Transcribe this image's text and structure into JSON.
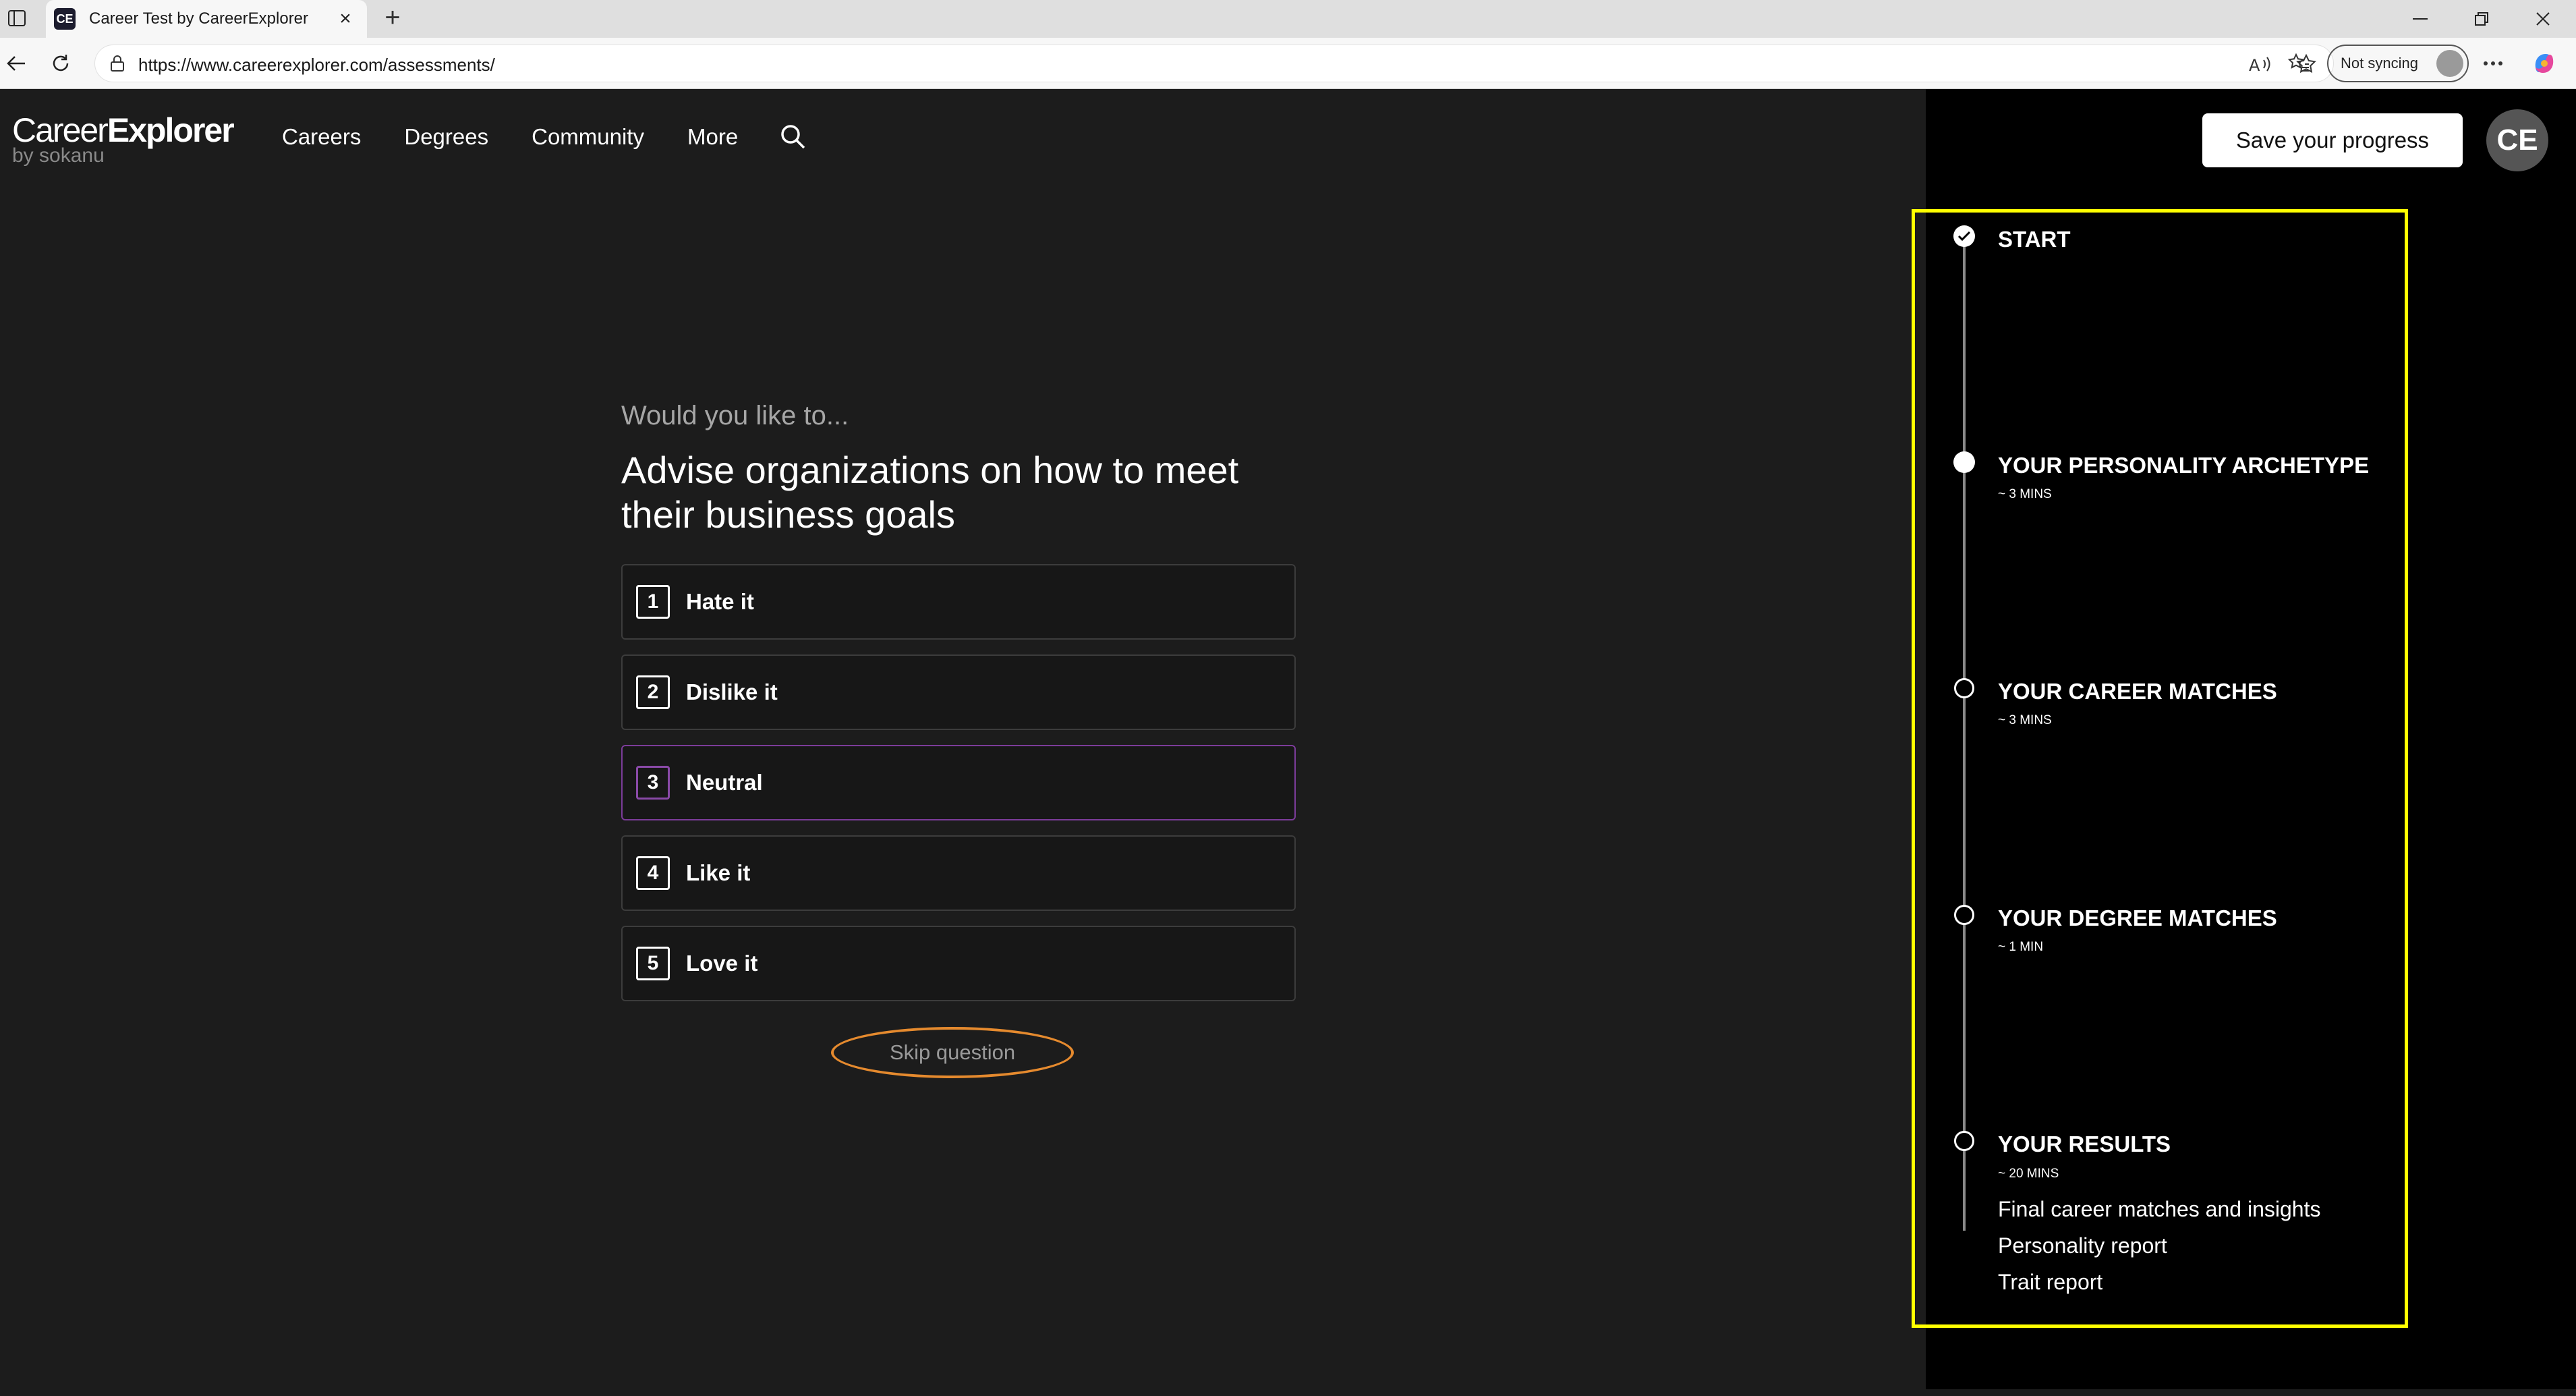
{
  "browser": {
    "tab_title": "Career Test by CareerExplorer",
    "tab_favicon": "CE",
    "new_tab_symbol": "+",
    "url": "https://www.careerexplorer.com/assessments/",
    "sync_label": "Not syncing"
  },
  "header": {
    "logo_main_light": "Career",
    "logo_main_bold": "Explorer",
    "logo_sub": "by sokanu",
    "nav": [
      "Careers",
      "Degrees",
      "Community",
      "More"
    ],
    "save_label": "Save your progress",
    "avatar_initials": "CE"
  },
  "question": {
    "intro": "Would you like to...",
    "text": "Advise organizations on how to meet their business goals",
    "options": [
      {
        "num": "1",
        "label": "Hate it"
      },
      {
        "num": "2",
        "label": "Dislike it"
      },
      {
        "num": "3",
        "label": "Neutral"
      },
      {
        "num": "4",
        "label": "Like it"
      },
      {
        "num": "5",
        "label": "Love it"
      }
    ],
    "selected_option": "3",
    "skip_label": "Skip question"
  },
  "progress": {
    "steps": [
      {
        "title": "START",
        "time": "",
        "state": "done"
      },
      {
        "title": "YOUR PERSONALITY ARCHETYPE",
        "time": "~ 3 MINS",
        "state": "current"
      },
      {
        "title": "YOUR CAREER MATCHES",
        "time": "~ 3 MINS",
        "state": "upcoming"
      },
      {
        "title": "YOUR DEGREE MATCHES",
        "time": "~ 1 MIN",
        "state": "upcoming"
      },
      {
        "title": "YOUR RESULTS",
        "time": "~ 20 MINS",
        "state": "upcoming"
      }
    ],
    "results_items": [
      "Final career matches and insights",
      "Personality report",
      "Trait report"
    ]
  },
  "colors": {
    "accent_selected": "#7c3c9a",
    "highlight_box": "#ffff00",
    "skip_ring": "#e58a2e"
  }
}
